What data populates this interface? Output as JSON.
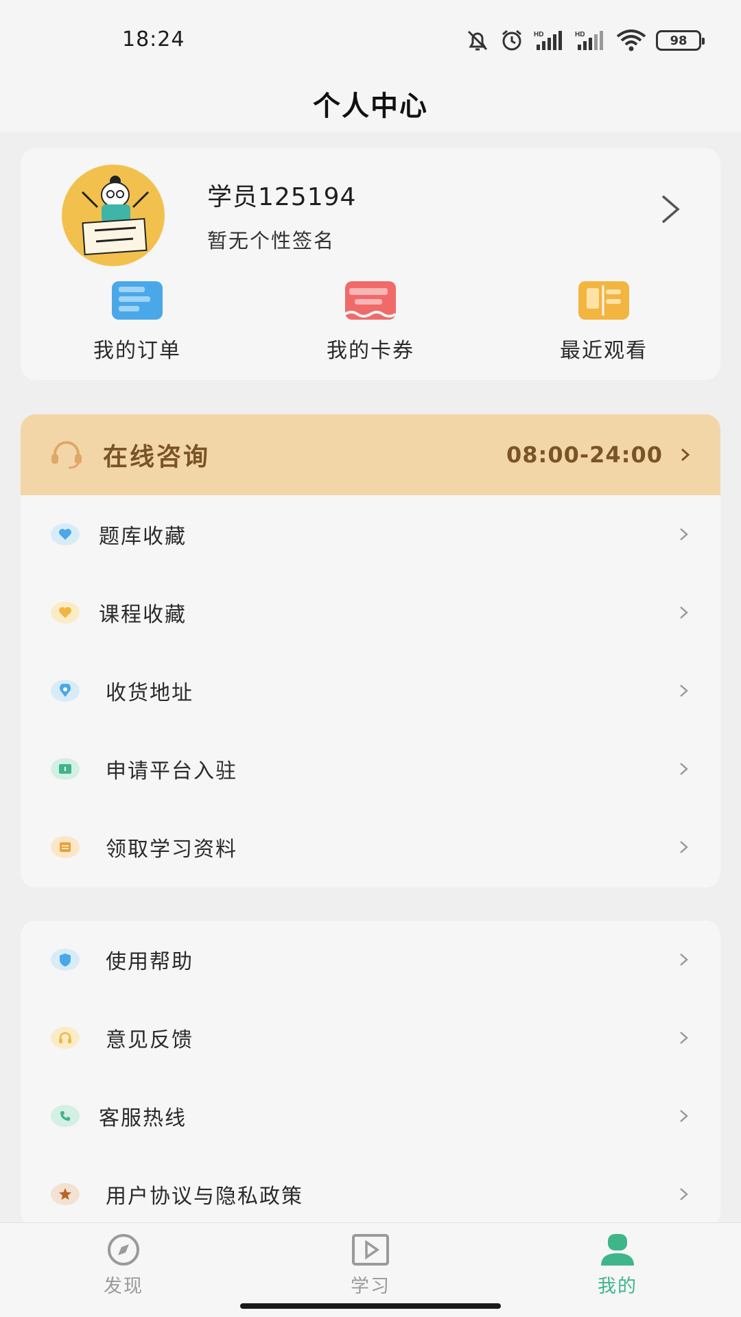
{
  "status_bar": {
    "time": "18:24",
    "battery": "98"
  },
  "header": {
    "title": "个人中心"
  },
  "profile": {
    "name": "学员125194",
    "signature": "暂无个性签名"
  },
  "quick_actions": [
    {
      "label": "我的订单",
      "icon": "order-icon",
      "color": "#4aa8e8"
    },
    {
      "label": "我的卡券",
      "icon": "coupon-icon",
      "color": "#f06a6a"
    },
    {
      "label": "最近观看",
      "icon": "book-icon",
      "color": "#f2b540"
    }
  ],
  "consult": {
    "title": "在线咨询",
    "hours": "08:00-24:00",
    "bg": "#f3d6a8",
    "text_color": "#7a5326"
  },
  "menu_main": [
    {
      "label": "题库收藏",
      "icon": "heart-icon",
      "color": "#4aa8e8"
    },
    {
      "label": "课程收藏",
      "icon": "heart-icon",
      "color": "#f2b540"
    },
    {
      "label": "收货地址",
      "icon": "location-icon",
      "color": "#4aa8e8"
    },
    {
      "label": "申请平台入驻",
      "icon": "book-open-icon",
      "color": "#3fb58a"
    },
    {
      "label": "领取学习资料",
      "icon": "document-icon",
      "color": "#e8a13a"
    }
  ],
  "menu_help": [
    {
      "label": "使用帮助",
      "icon": "shield-icon",
      "color": "#4aa8e8"
    },
    {
      "label": "意见反馈",
      "icon": "headset-icon",
      "color": "#f2b540"
    },
    {
      "label": "客服热线",
      "icon": "phone-icon",
      "color": "#3fb58a"
    },
    {
      "label": "用户协议与隐私政策",
      "icon": "star-icon",
      "color": "#b8652a"
    }
  ],
  "tabs": [
    {
      "label": "发现",
      "icon": "compass-icon",
      "active": false
    },
    {
      "label": "学习",
      "icon": "play-icon",
      "active": false
    },
    {
      "label": "我的",
      "icon": "person-icon",
      "active": true
    }
  ],
  "accent_color": "#3fb58a"
}
